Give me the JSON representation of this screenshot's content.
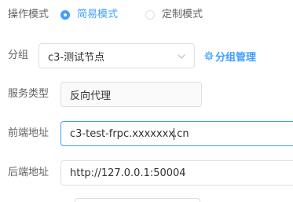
{
  "mode": {
    "label": "操作模式",
    "options": [
      {
        "label": "简易模式",
        "checked": true
      },
      {
        "label": "定制模式",
        "checked": false
      }
    ]
  },
  "group": {
    "label": "分组",
    "selected": "c3-测试节点",
    "manage_link": "分组管理"
  },
  "service_type": {
    "label": "服务类型",
    "value": "反向代理"
  },
  "frontend": {
    "label": "前端地址",
    "value_before_cursor": "c3-test-frpc.xxxxxxx",
    "value_after_cursor": ".cn"
  },
  "backend": {
    "label": "后端地址",
    "value": "http://127.0.0.1:50004"
  },
  "colors": {
    "accent": "#409eff",
    "border": "#dcdfe6",
    "label": "#606266"
  }
}
